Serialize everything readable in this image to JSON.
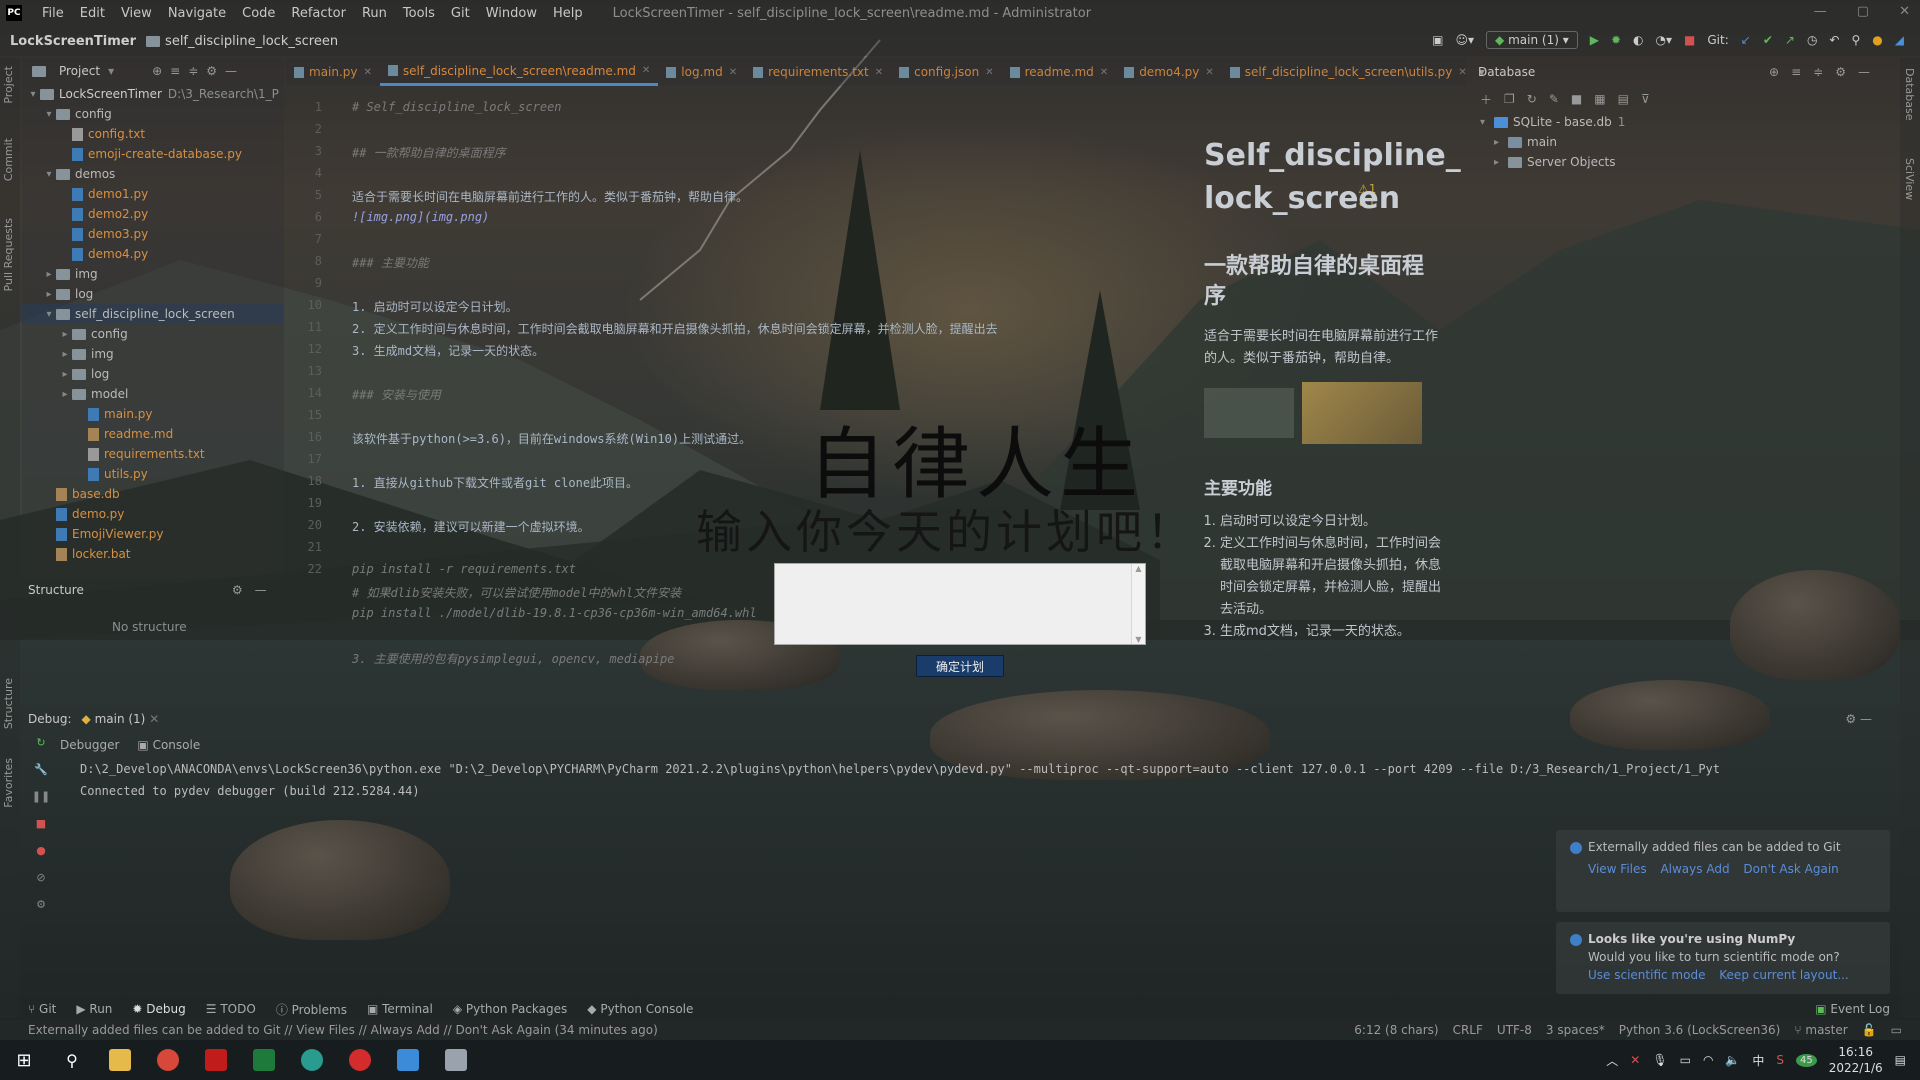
{
  "menu": {
    "items": [
      "File",
      "Edit",
      "View",
      "Navigate",
      "Code",
      "Refactor",
      "Run",
      "Tools",
      "Git",
      "Window",
      "Help"
    ],
    "window_title": "LockScreenTimer - self_discipline_lock_screen\\readme.md - Administrator"
  },
  "navbar": {
    "project": "LockScreenTimer",
    "folder": "self_discipline_lock_screen",
    "run_config": "main (1)",
    "git_label": "Git:"
  },
  "project_panel": {
    "title": "Project",
    "root": "LockScreenTimer",
    "root_path": "D:\\3_Research\\1_P",
    "rows": [
      {
        "name": "config",
        "type": "folder",
        "indent": 1,
        "open": true
      },
      {
        "name": "config.txt",
        "type": "txt",
        "indent": 2
      },
      {
        "name": "emoji-create-database.py",
        "type": "py",
        "indent": 2
      },
      {
        "name": "demos",
        "type": "folder",
        "indent": 1,
        "open": true
      },
      {
        "name": "demo1.py",
        "type": "py",
        "indent": 2
      },
      {
        "name": "demo2.py",
        "type": "py",
        "indent": 2
      },
      {
        "name": "demo3.py",
        "type": "py",
        "indent": 2
      },
      {
        "name": "demo4.py",
        "type": "py",
        "indent": 2
      },
      {
        "name": "img",
        "type": "folder",
        "indent": 1
      },
      {
        "name": "log",
        "type": "folder",
        "indent": 1
      },
      {
        "name": "self_discipline_lock_screen",
        "type": "folder",
        "indent": 1,
        "open": true,
        "selected": true
      },
      {
        "name": "config",
        "type": "folder",
        "indent": 2
      },
      {
        "name": "img",
        "type": "folder",
        "indent": 2
      },
      {
        "name": "log",
        "type": "folder",
        "indent": 2
      },
      {
        "name": "model",
        "type": "folder",
        "indent": 2
      },
      {
        "name": "main.py",
        "type": "py",
        "indent": 3
      },
      {
        "name": "readme.md",
        "type": "md",
        "indent": 3
      },
      {
        "name": "requirements.txt",
        "type": "txt",
        "indent": 3
      },
      {
        "name": "utils.py",
        "type": "py",
        "indent": 3
      },
      {
        "name": "base.db",
        "type": "db",
        "indent": 1
      },
      {
        "name": "demo.py",
        "type": "py",
        "indent": 1
      },
      {
        "name": "EmojiViewer.py",
        "type": "py",
        "indent": 1
      },
      {
        "name": "locker.bat",
        "type": "bat",
        "indent": 1
      }
    ]
  },
  "structure_panel": {
    "title": "Structure",
    "empty": "No structure"
  },
  "tabs": [
    {
      "label": "main.py",
      "active": false
    },
    {
      "label": "self_discipline_lock_screen\\readme.md",
      "active": true
    },
    {
      "label": "log.md",
      "active": false
    },
    {
      "label": "requirements.txt",
      "active": false
    },
    {
      "label": "config.json",
      "active": false
    },
    {
      "label": "readme.md",
      "active": false
    },
    {
      "label": "demo4.py",
      "active": false
    },
    {
      "label": "self_discipline_lock_screen\\utils.py",
      "active": false
    }
  ],
  "editor": {
    "inspections": "⚠1 ✔1",
    "line_numbers": [
      "1",
      "2",
      "3",
      "4",
      "5",
      "6",
      "7",
      "8",
      "9",
      "10",
      "11",
      "12",
      "13",
      "14",
      "15",
      "16",
      "17",
      "18",
      "19",
      "20",
      "21",
      "22"
    ],
    "lines": [
      {
        "text": "# Self_discipline_lock_screen",
        "cls": "c-com"
      },
      {
        "text": "",
        "cls": "c-txt"
      },
      {
        "text": "## 一款帮助自律的桌面程序",
        "cls": "c-com"
      },
      {
        "text": "",
        "cls": "c-txt"
      },
      {
        "text": "适合于需要长时间在电脑屏幕前进行工作的人。类似于番茄钟，帮助自律。",
        "cls": "c-txt"
      },
      {
        "text": "![img.png](img.png)",
        "cls": "c-link"
      },
      {
        "text": "",
        "cls": "c-txt"
      },
      {
        "text": "### 主要功能",
        "cls": "c-com"
      },
      {
        "text": "",
        "cls": "c-txt"
      },
      {
        "text": "1. 启动时可以设定今日计划。",
        "cls": "c-txt"
      },
      {
        "text": "2. 定义工作时间与休息时间，工作时间会截取电脑屏幕和开启摄像头抓拍，休息时间会锁定屏幕，并检测人脸，提醒出去",
        "cls": "c-txt"
      },
      {
        "text": "3. 生成md文档，记录一天的状态。",
        "cls": "c-txt"
      },
      {
        "text": "",
        "cls": "c-txt"
      },
      {
        "text": "### 安装与使用",
        "cls": "c-com"
      },
      {
        "text": "",
        "cls": "c-txt"
      },
      {
        "text": "该软件基于python(>=3.6)，目前在windows系统(Win10)上测试通过。",
        "cls": "c-txt"
      },
      {
        "text": "",
        "cls": "c-txt"
      },
      {
        "text": "1. 直接从github下载文件或者git clone此项目。",
        "cls": "c-txt"
      },
      {
        "text": "",
        "cls": "c-txt"
      },
      {
        "text": "2. 安装依赖，建议可以新建一个虚拟环境。",
        "cls": "c-txt"
      },
      {
        "text": "",
        "cls": "c-txt"
      },
      {
        "text": "pip install -r requirements.txt",
        "cls": "c-com"
      }
    ],
    "extra_lines": [
      "# 如果dlib安装失败，可以尝试使用model中的whl文件安装",
      "pip install ./model/dlib-19.8.1-cp36-cp36m-win_amd64.whl",
      "",
      "3. 主要使用的包有pysimplegui, opencv, mediapipe"
    ]
  },
  "preview": {
    "title": "Self_discipline_lock_screen",
    "subtitle": "一款帮助自律的桌面程序",
    "intro": "适合于需要长时间在电脑屏幕前进行工作的人。类似于番茄钟，帮助自律。",
    "features_title": "主要功能",
    "features": [
      "启动时可以设定今日计划。",
      "定义工作时间与休息时间，工作时间会截取电脑屏幕和开启摄像头抓拍，休息时间会锁定屏幕，并检测人脸，提醒出去活动。",
      "生成md文档，记录一天的状态。"
    ]
  },
  "database": {
    "title": "Database",
    "rows": [
      {
        "label": "SQLite - base.db",
        "badge": "1"
      },
      {
        "label": "main",
        "badge": ""
      },
      {
        "label": "Server Objects",
        "badge": ""
      }
    ]
  },
  "lock_screen": {
    "title": "自律人生",
    "subtitle": "输入你今天的计划吧！",
    "input_value": "",
    "confirm_label": "确定计划"
  },
  "debug": {
    "label": "Debug:",
    "config": "main (1)",
    "tabs": [
      "Debugger",
      "Console"
    ],
    "console_lines": [
      "D:\\2_Develop\\ANACONDA\\envs\\LockScreen36\\python.exe \"D:\\2_Develop\\PYCHARM\\PyCharm 2021.2.2\\plugins\\python\\helpers\\pydev\\pydevd.py\" --multiproc --qt-support=auto --client 127.0.0.1 --port 4209 --file D:/3_Research/1_Project/1_Pyt",
      "Connected to pydev debugger (build 212.5284.44)"
    ]
  },
  "notifications": [
    {
      "title": "",
      "body": "Externally added files can be added to Git",
      "links": [
        "View Files",
        "Always Add",
        "Don't Ask Again"
      ]
    },
    {
      "title": "Looks like you're using NumPy",
      "body": "Would you like to turn scientific mode on?",
      "links": [
        "Use scientific mode",
        "Keep current layout..."
      ]
    }
  ],
  "bottom_tabs": [
    "Git",
    "Run",
    "Debug",
    "TODO",
    "Problems",
    "Terminal",
    "Python Packages",
    "Python Console"
  ],
  "event_log": "Event Log",
  "status": {
    "message": "Externally added files can be added to Git // View Files // Always Add // Don't Ask Again (34 minutes ago)",
    "position": "6:12 (8 chars)",
    "line_sep": "CRLF",
    "encoding": "UTF-8",
    "indent": "3 spaces*",
    "interpreter": "Python 3.6 (LockScreen36)",
    "branch": "master"
  },
  "taskbar": {
    "time": "16:16",
    "date": "2022/1/6",
    "ime": "中",
    "badge": "45"
  },
  "left_strip": [
    "Project",
    "Commit",
    "Pull Requests",
    "Structure",
    "Favorites"
  ],
  "right_strip": [
    "Database",
    "SciView"
  ]
}
